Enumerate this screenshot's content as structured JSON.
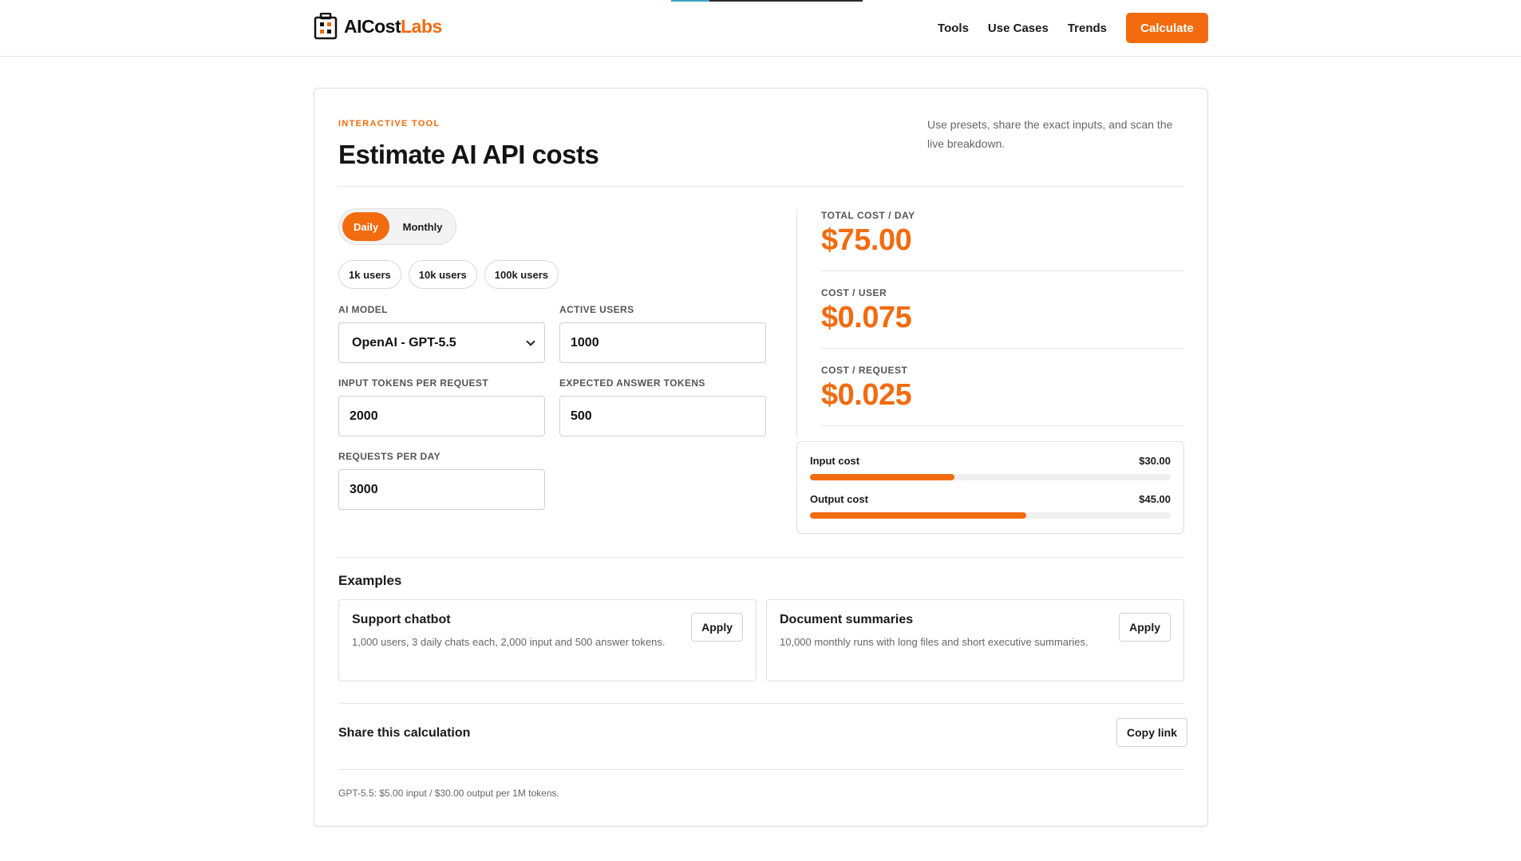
{
  "header": {
    "logo_main": "AICost",
    "logo_accent": "Labs",
    "nav": [
      "Tools",
      "Use Cases",
      "Trends"
    ],
    "cta_label": "Calculate"
  },
  "card": {
    "eyebrow": "INTERACTIVE TOOL",
    "title": "Estimate AI API costs",
    "intro": "Use presets, share the exact inputs, and scan the live breakdown.",
    "toggle": {
      "active": "Daily",
      "inactive": "Monthly"
    },
    "presets": [
      "1k users",
      "10k users",
      "100k users"
    ],
    "fields": {
      "model": {
        "label": "AI MODEL",
        "value": "OpenAI - GPT-5.5"
      },
      "users": {
        "label": "ACTIVE USERS",
        "value": "1000"
      },
      "input_tokens": {
        "label": "INPUT TOKENS PER REQUEST",
        "value": "2000"
      },
      "answer_tokens": {
        "label": "EXPECTED ANSWER TOKENS",
        "value": "500"
      },
      "requests": {
        "label": "REQUESTS PER DAY",
        "value": "3000"
      }
    },
    "metrics": [
      {
        "label": "TOTAL COST / DAY",
        "value": "$75.00"
      },
      {
        "label": "COST / USER",
        "value": "$0.075"
      },
      {
        "label": "COST / REQUEST",
        "value": "$0.025"
      }
    ],
    "breakdown": [
      {
        "label": "Input cost",
        "value": "$30.00",
        "fraction": 0.4
      },
      {
        "label": "Output cost",
        "value": "$45.00",
        "fraction": 0.6
      }
    ],
    "examples": {
      "title": "Examples",
      "items": [
        {
          "title": "Support chatbot",
          "desc": "1,000 users, 3 daily chats each, 2,000 input and 500 answer tokens.",
          "button": "Apply"
        },
        {
          "title": "Document summaries",
          "desc": "10,000 monthly runs with long files and short executive summaries.",
          "button": "Apply"
        }
      ]
    },
    "share": {
      "title": "Share this calculation",
      "button": "Copy link"
    },
    "footnote": "GPT-5.5: $5.00 input / $30.00 output per 1M tokens."
  },
  "colors": {
    "accent": "#f26b0f",
    "text": "#1a1a1a",
    "muted": "#666666",
    "border": "#e0e0e0"
  }
}
